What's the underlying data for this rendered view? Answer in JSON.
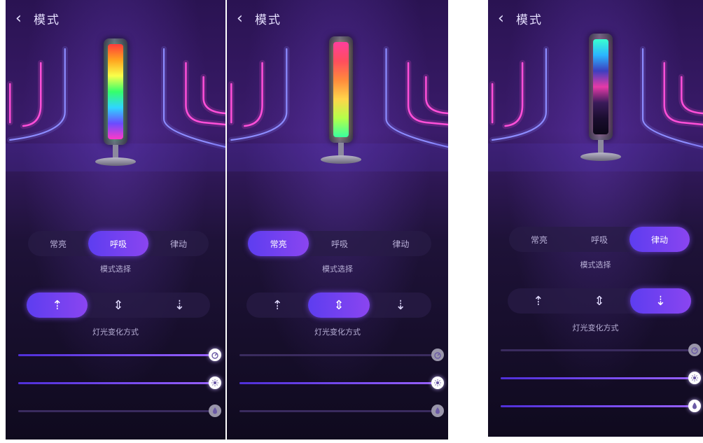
{
  "panels": [
    {
      "id": "p1",
      "header": {
        "back_icon": "‹",
        "title": "模式"
      },
      "lamp": {
        "gradient": [
          "#ff3b3b",
          "#ffa31f",
          "#f9ff4a",
          "#35ff6b",
          "#2fd6ff",
          "#6b4cff",
          "#ff39c8"
        ]
      },
      "mode_tabs": {
        "options": [
          "常亮",
          "呼吸",
          "律动"
        ],
        "selected": 1
      },
      "mode_caption": "模式选择",
      "direction_tabs": {
        "options": [
          "⇡",
          "⇕",
          "⇣"
        ],
        "selected": 0
      },
      "direction_caption": "灯光变化方式",
      "sliders": [
        {
          "name": "speed",
          "icon": "speed-icon",
          "value": 1.0
        },
        {
          "name": "brightness",
          "icon": "brightness-icon",
          "value": 1.0
        },
        {
          "name": "sensitivity",
          "icon": "sensitivity-icon",
          "value": 0.0
        }
      ]
    },
    {
      "id": "p2",
      "header": {
        "back_icon": "‹",
        "title": "模式"
      },
      "lamp": {
        "gradient": [
          "#ff3e9c",
          "#ff4d5e",
          "#ff8a3c",
          "#ffd54a",
          "#b4ff4a",
          "#3aff9e"
        ]
      },
      "mode_tabs": {
        "options": [
          "常亮",
          "呼吸",
          "律动"
        ],
        "selected": 0
      },
      "mode_caption": "模式选择",
      "direction_tabs": {
        "options": [
          "⇡",
          "⇕",
          "⇣"
        ],
        "selected": 1
      },
      "direction_caption": "灯光变化方式",
      "sliders": [
        {
          "name": "speed",
          "icon": "speed-icon",
          "value": 0.0
        },
        {
          "name": "brightness",
          "icon": "brightness-icon",
          "value": 1.0
        },
        {
          "name": "sensitivity",
          "icon": "sensitivity-icon",
          "value": 0.0
        }
      ]
    },
    {
      "id": "p3",
      "header": {
        "back_icon": "‹",
        "title": "模式"
      },
      "lamp": {
        "gradient": [
          "#3affd0",
          "#2bb6ff",
          "#3d3fbf",
          "#e63aa8",
          "#3a1b5a",
          "#1a0d2e",
          "#0c0718"
        ]
      },
      "mode_tabs": {
        "options": [
          "常亮",
          "呼吸",
          "律动"
        ],
        "selected": 2
      },
      "mode_caption": "模式选择",
      "direction_tabs": {
        "options": [
          "⇡",
          "⇕",
          "⇣"
        ],
        "selected": 2
      },
      "direction_caption": "灯光变化方式",
      "sliders": [
        {
          "name": "speed",
          "icon": "speed-icon",
          "value": 0.0
        },
        {
          "name": "brightness",
          "icon": "brightness-icon",
          "value": 1.0
        },
        {
          "name": "sensitivity",
          "icon": "sensitivity-icon",
          "value": 1.0
        }
      ]
    }
  ],
  "colors": {
    "accent_start": "#5d3df0",
    "accent_end": "#8a45f0",
    "neon_pink": "#ff4fd8",
    "neon_blue": "#8c8cff",
    "bg_top": "#2a1352",
    "bg_bottom": "#0f0a1e"
  }
}
